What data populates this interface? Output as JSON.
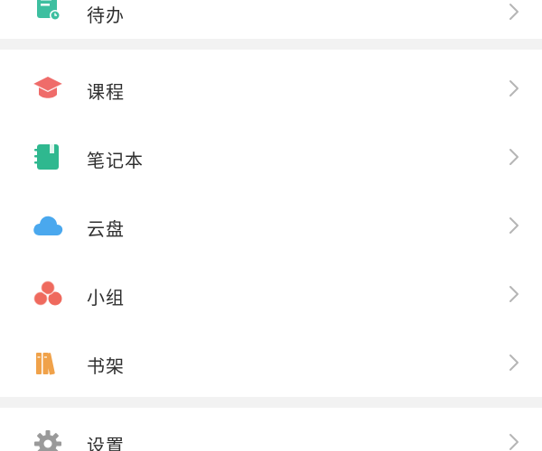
{
  "menu": {
    "top_item": {
      "label": "待办",
      "icon": "todo-icon",
      "color": "#3ebfa0"
    },
    "main_items": [
      {
        "label": "课程",
        "icon": "course-icon",
        "color": "#ef6c6a"
      },
      {
        "label": "笔记本",
        "icon": "notebook-icon",
        "color": "#2fb88f"
      },
      {
        "label": "云盘",
        "icon": "cloud-drive-icon",
        "color": "#4aa8ee"
      },
      {
        "label": "小组",
        "icon": "group-icon",
        "color": "#ef6a5e"
      },
      {
        "label": "书架",
        "icon": "bookshelf-icon",
        "color": "#f0a24a"
      }
    ],
    "bottom_item": {
      "label": "设置",
      "icon": "settings-icon",
      "color": "#9a9a9a"
    }
  }
}
